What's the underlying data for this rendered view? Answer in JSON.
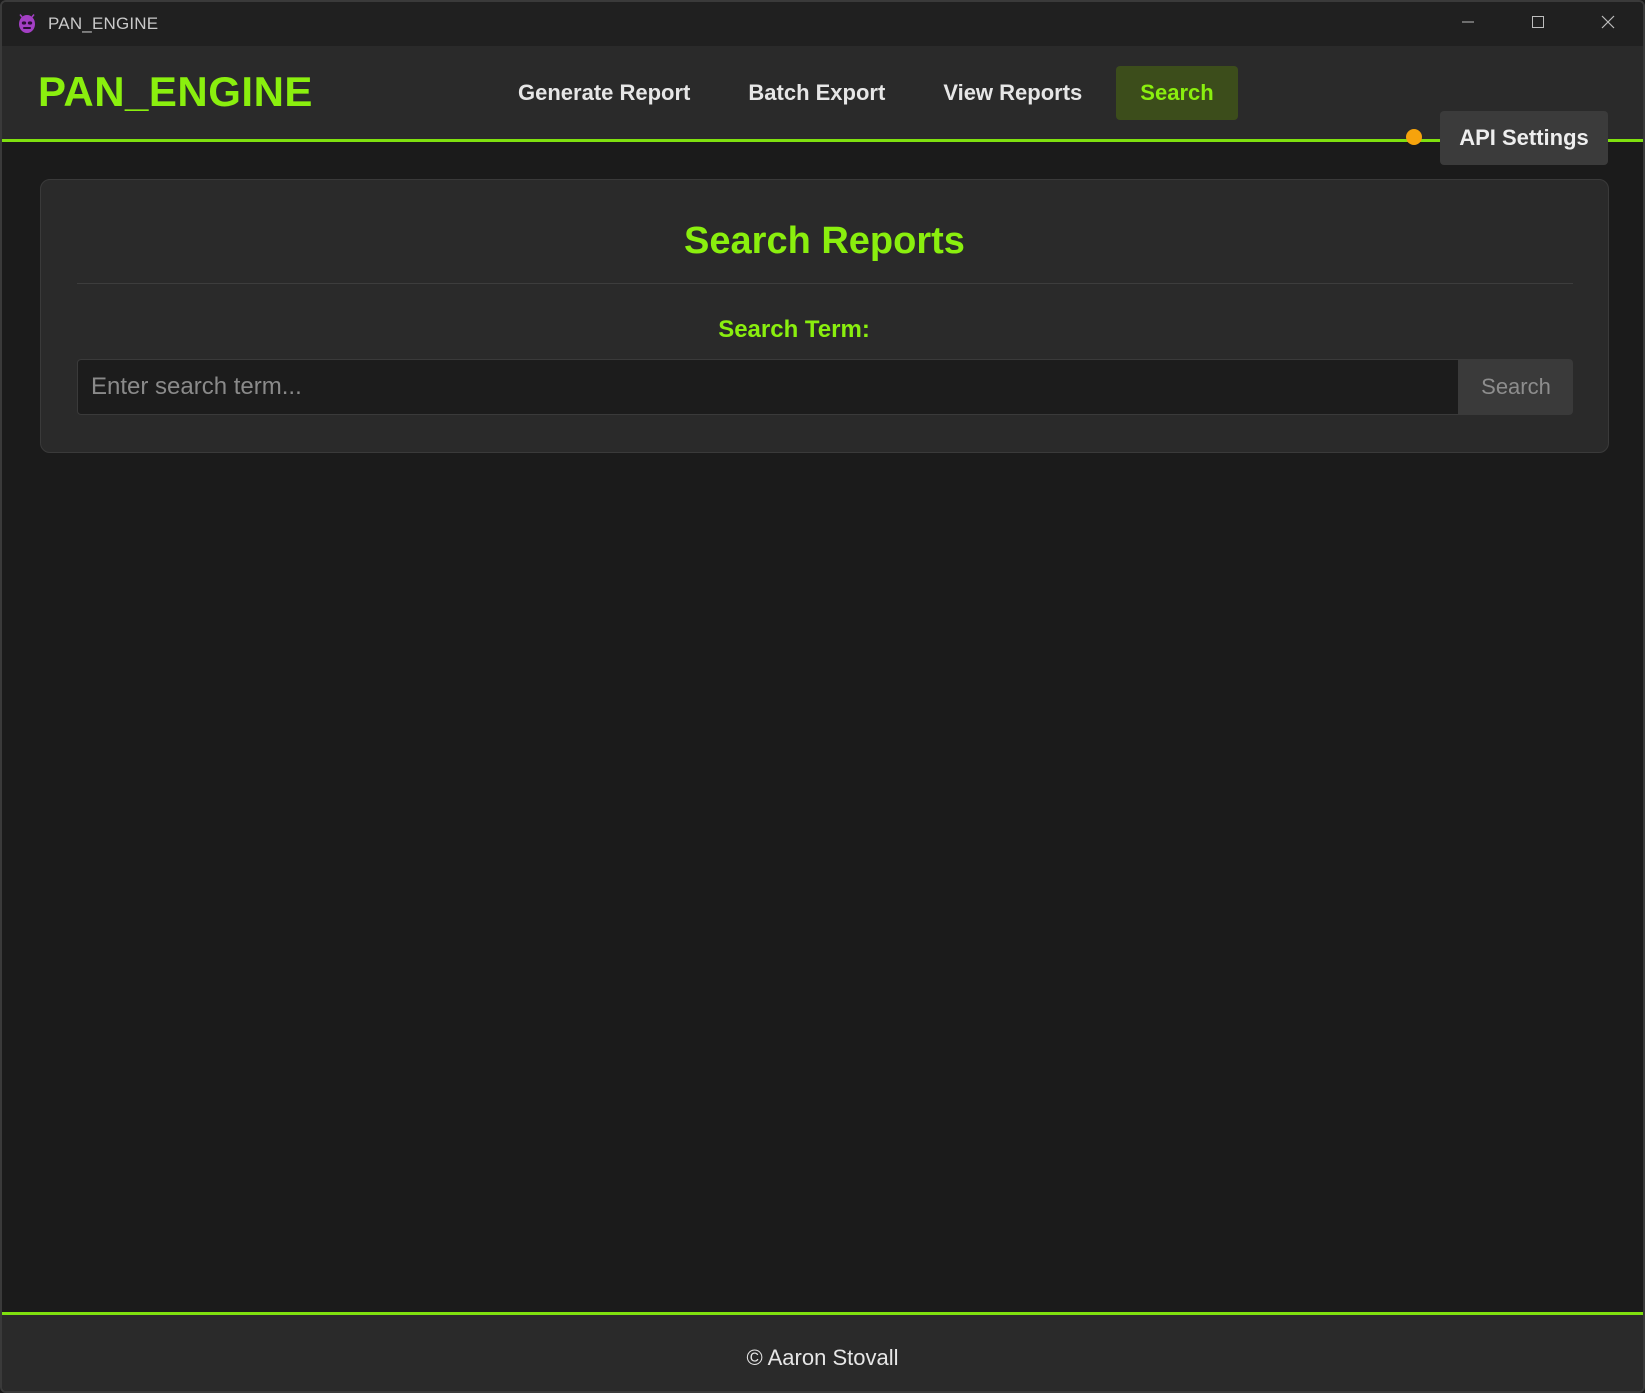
{
  "window": {
    "title": "PAN_ENGINE",
    "app_icon": "alien-icon",
    "controls": [
      "minimize-icon",
      "maximize-icon",
      "close-icon"
    ]
  },
  "header": {
    "logo": "PAN_ENGINE",
    "nav": [
      {
        "label": "Generate Report",
        "active": false
      },
      {
        "label": "Batch Export",
        "active": false
      },
      {
        "label": "View Reports",
        "active": false
      },
      {
        "label": "Search",
        "active": true
      }
    ],
    "status_indicator_color": "#f6a30c",
    "api_settings_label": "API Settings"
  },
  "search_panel": {
    "title": "Search Reports",
    "label": "Search Term:",
    "input_value": "",
    "input_placeholder": "Enter search term...",
    "button_label": "Search"
  },
  "footer": {
    "text": "© Aaron Stovall"
  },
  "colors": {
    "accent": "#8aef0e",
    "background": "#1b1b1b",
    "panel": "#2a2a2a",
    "active_nav_bg": "#3c4d1b"
  }
}
